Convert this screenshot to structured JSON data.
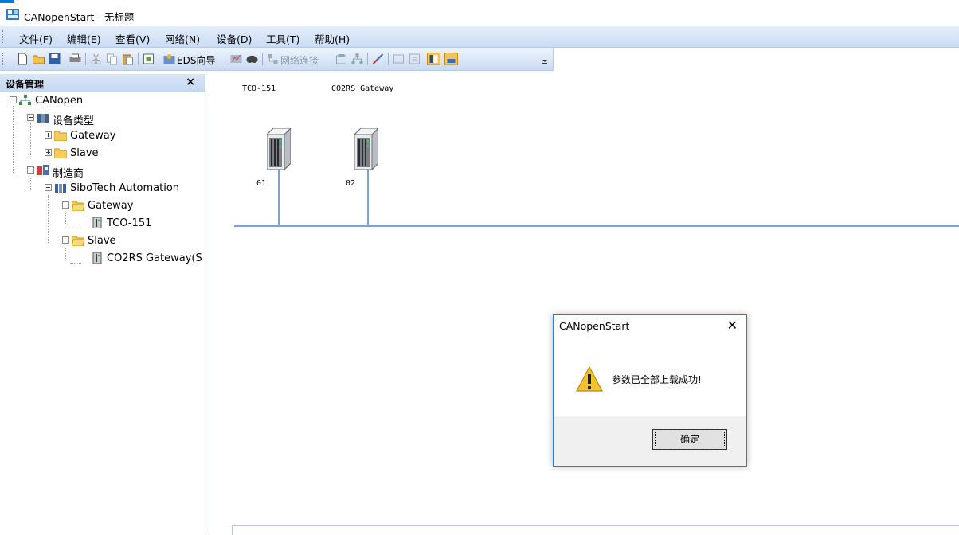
{
  "window": {
    "title": "CANopenStart - 无标题"
  },
  "menu": [
    "文件(F)",
    "编辑(E)",
    "查看(V)",
    "网络(N)",
    "设备(D)",
    "工具(T)",
    "帮助(H)"
  ],
  "toolbar": {
    "eds_wizard": "EDS向导",
    "network_connect": "网络连接"
  },
  "panel": {
    "title": "设备管理",
    "close": "×"
  },
  "tree": {
    "root": "CANopen",
    "device_types": "设备类型",
    "gateway": "Gateway",
    "slave": "Slave",
    "manufacturers": "制造商",
    "vendor": "SiboTech Automation",
    "vendor_gateway": "Gateway",
    "tco151": "TCO-151",
    "vendor_slave": "Slave",
    "co2rs": "CO2RS Gateway(S"
  },
  "network": {
    "devices": [
      {
        "name": "TCO-151",
        "address": "01"
      },
      {
        "name": "CO2RS Gateway",
        "address": "02"
      }
    ]
  },
  "dialog": {
    "title": "CANopenStart",
    "close": "✕",
    "message": "参数已全部上载成功!",
    "ok": "确定"
  }
}
